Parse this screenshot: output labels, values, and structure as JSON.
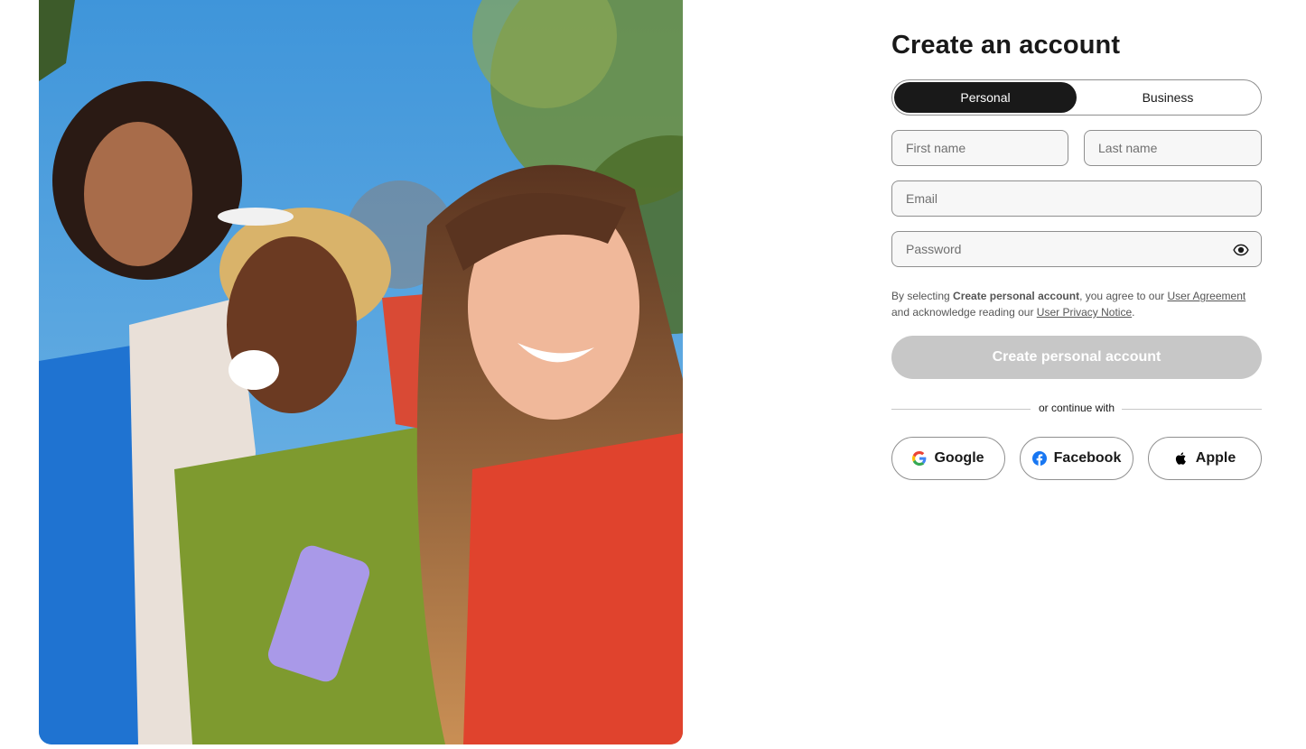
{
  "hero": {},
  "form": {
    "title": "Create an account",
    "account_types": [
      {
        "label": "Personal",
        "selected": true
      },
      {
        "label": "Business",
        "selected": false
      }
    ],
    "fields": {
      "first_name": {
        "placeholder": "First name",
        "value": ""
      },
      "last_name": {
        "placeholder": "Last name",
        "value": ""
      },
      "email": {
        "placeholder": "Email",
        "value": ""
      },
      "password": {
        "placeholder": "Password",
        "value": ""
      }
    },
    "legal": {
      "prefix": "By selecting ",
      "bold": "Create personal account",
      "middle": ", you agree to our ",
      "link1": "User Agreement",
      "middle2": " and acknowledge reading our ",
      "link2": "User Privacy Notice",
      "suffix": "."
    },
    "submit_label": "Create personal account",
    "divider_text": "or continue with",
    "social": {
      "google": "Google",
      "facebook": "Facebook",
      "apple": "Apple"
    },
    "colors": {
      "primary_disabled": "#c7c7c7",
      "segment_active": "#191919",
      "border": "#8f8f8f",
      "facebook": "#1877f2"
    },
    "icons": {
      "password_toggle": "eye-icon",
      "google": "google-logo-icon",
      "facebook": "facebook-logo-icon",
      "apple": "apple-logo-icon"
    }
  }
}
